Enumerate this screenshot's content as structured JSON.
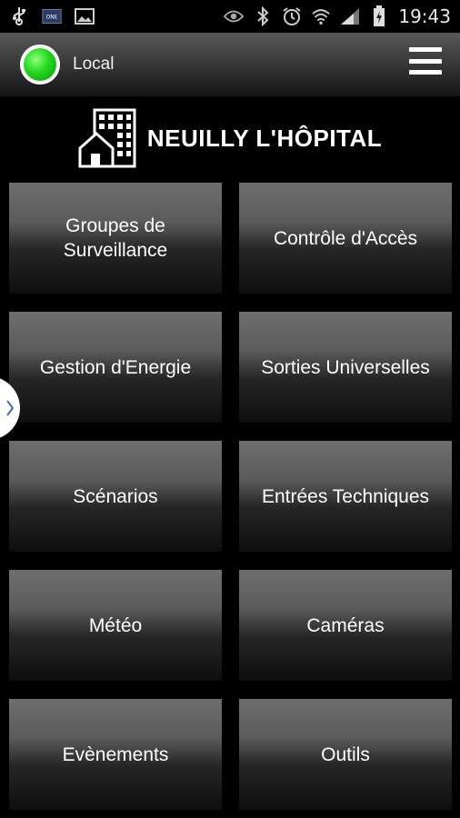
{
  "status_bar": {
    "time": "19:43",
    "icons": [
      "usb-icon",
      "app-notification-icon",
      "image-icon",
      "eye-icon",
      "bluetooth-icon",
      "alarm-icon",
      "wifi-icon",
      "signal-icon",
      "battery-charging-icon"
    ]
  },
  "header": {
    "connection_label": "Local",
    "connection_status_color": "#22d81c",
    "menu_icon": "hamburger-menu-icon"
  },
  "site": {
    "name": "NEUILLY L'HÔPITAL",
    "icon": "building-house-icon"
  },
  "tiles": [
    {
      "label": "Groupes de Surveillance"
    },
    {
      "label": "Contrôle d'Accès"
    },
    {
      "label": "Gestion d'Energie"
    },
    {
      "label": "Sorties Universelles"
    },
    {
      "label": "Scénarios"
    },
    {
      "label": "Entrées Techniques"
    },
    {
      "label": "Météo"
    },
    {
      "label": "Caméras"
    },
    {
      "label": "Evènements"
    },
    {
      "label": "Outils"
    }
  ],
  "drawer_handle_icon": "chevron-right-icon"
}
